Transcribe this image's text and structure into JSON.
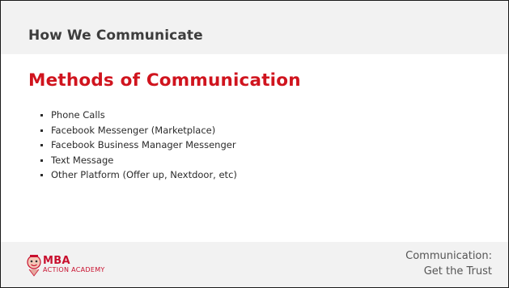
{
  "header": {
    "title": "How We Communicate"
  },
  "main": {
    "title": "Methods of Communication",
    "bullets": [
      "Phone Calls",
      "Facebook Messenger (Marketplace)",
      "Facebook Business Manager Messenger",
      "Text Message",
      "Other Platform (Offer up, Nextdoor, etc)"
    ]
  },
  "footer": {
    "logo": {
      "brand": "MBA",
      "subtitle": "ACTION ACADEMY",
      "icon": "mascot-logo-icon"
    },
    "caption_line1": "Communication:",
    "caption_line2": "Get the Trust"
  },
  "colors": {
    "accent_red": "#d0141e",
    "header_bg": "#f2f2f2",
    "text_dark": "#2b2b2b"
  }
}
